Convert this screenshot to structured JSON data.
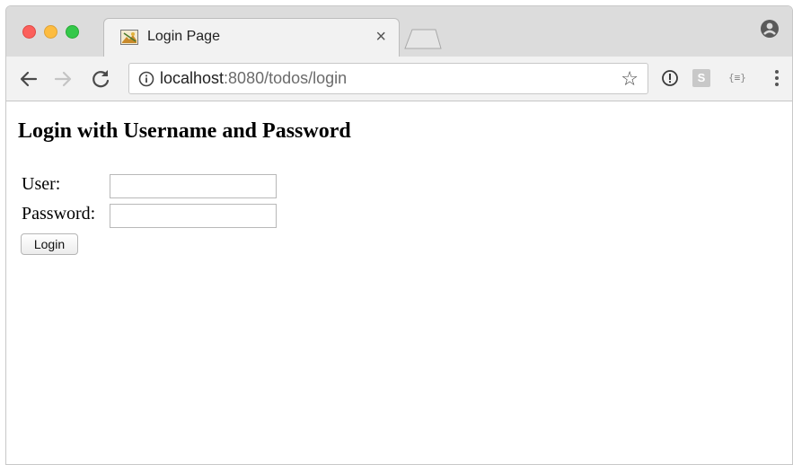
{
  "browser": {
    "tab": {
      "title": "Login Page",
      "close_glyph": "×",
      "favicon": "broken-image-icon"
    },
    "toolbar": {
      "url_host": "localhost",
      "url_rest": ":8080/todos/login",
      "star_glyph": "☆",
      "extension_s_label": "S",
      "extension_json_label": "{≡}"
    },
    "icons": [
      "back-arrow-icon",
      "forward-arrow-icon",
      "reload-icon",
      "info-icon",
      "star-icon",
      "profile-icon",
      "menu-icon"
    ]
  },
  "page": {
    "title": "Login with Username and Password",
    "user_label": "User:",
    "password_label": "Password:",
    "user_value": "",
    "password_value": "",
    "login_button": "Login"
  },
  "colors": {
    "traffic_red": "#fc605c",
    "traffic_yellow": "#fdbc40",
    "traffic_green": "#34c84a"
  }
}
